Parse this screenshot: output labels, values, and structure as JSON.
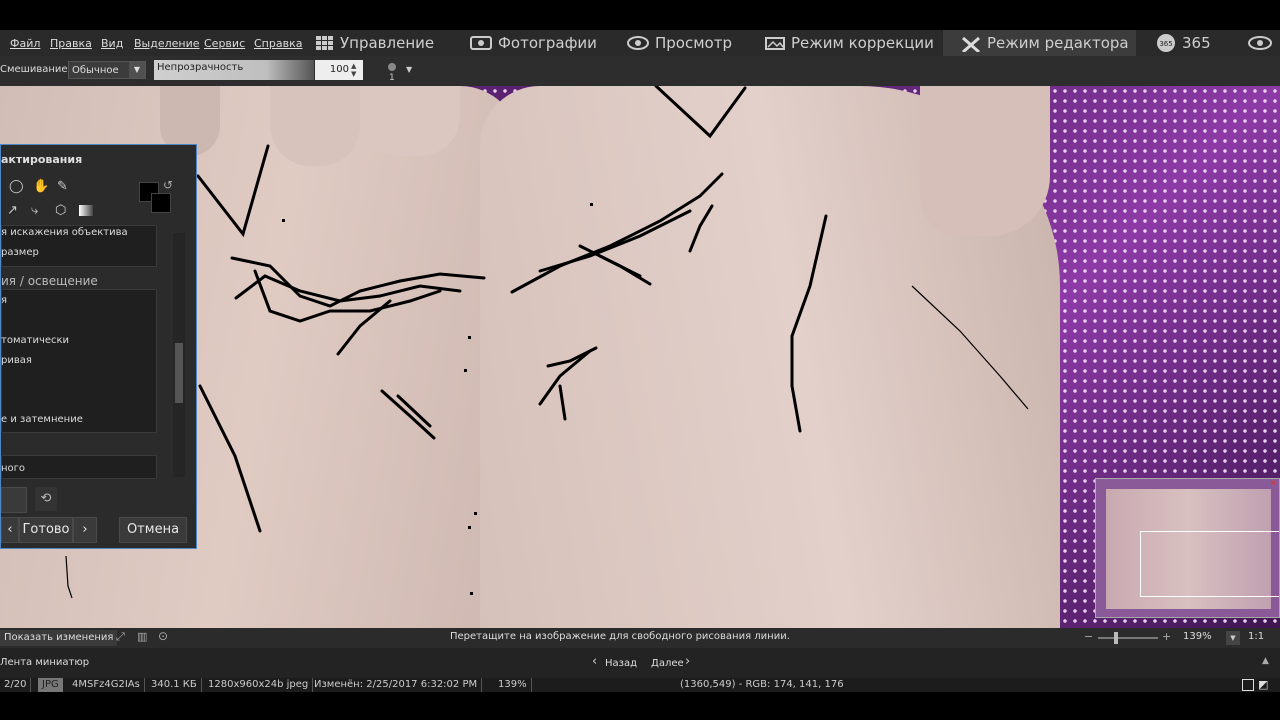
{
  "menu": [
    "Файл",
    "Правка",
    "Вид",
    "Выделение",
    "Сервис",
    "Справка"
  ],
  "modes": [
    {
      "label": "Управление",
      "icon": "grid-icon"
    },
    {
      "label": "Фотографии",
      "icon": "photos-icon"
    },
    {
      "label": "Просмотр",
      "icon": "eye-icon"
    },
    {
      "label": "Режим коррекции",
      "icon": "develop-icon"
    },
    {
      "label": "Режим редактора",
      "icon": "tools-icon"
    },
    {
      "label": "365",
      "icon": "365-icon"
    }
  ],
  "toolbar": {
    "blend_label": "Смешивание:",
    "blend_value": "Обычное",
    "opacity_label": "Непрозрачность",
    "opacity_value": "100",
    "brush_size": "1"
  },
  "panel": {
    "title": "актирования",
    "items": [
      {
        "label": "я искажения объектива"
      },
      {
        "label": "размер"
      }
    ],
    "section": "ия / освещение",
    "items2": [
      {
        "label": "я"
      },
      {
        "label": "томатически"
      },
      {
        "label": "ривая"
      },
      {
        "label": "е и затемнение"
      }
    ],
    "item_last": "ного",
    "done_label": "Готово",
    "cancel_label": "Отмена"
  },
  "status": {
    "show_changes": "Показать изменения",
    "hint": "Перетащите на изображение для свободного рисования линии.",
    "zoom": "139%",
    "ratio": "1:1",
    "filmstrip": "Лента миниатюр",
    "back": "Назад",
    "next": "Далее"
  },
  "info": {
    "index": "2/20",
    "format": "JPG",
    "filename": "4MSFz4G2IAs",
    "size": "340.1 КБ",
    "dims": "1280x960x24b jpeg",
    "modified": "Изменён: 2/25/2017 6:32:02 PM",
    "zoom": "139%",
    "pixel": "(1360,549) - RGB: 174, 141, 176"
  },
  "colors": {
    "accent": "#4d87c7",
    "bg": "#2b2b2b",
    "fabric": "#7a2d90"
  }
}
